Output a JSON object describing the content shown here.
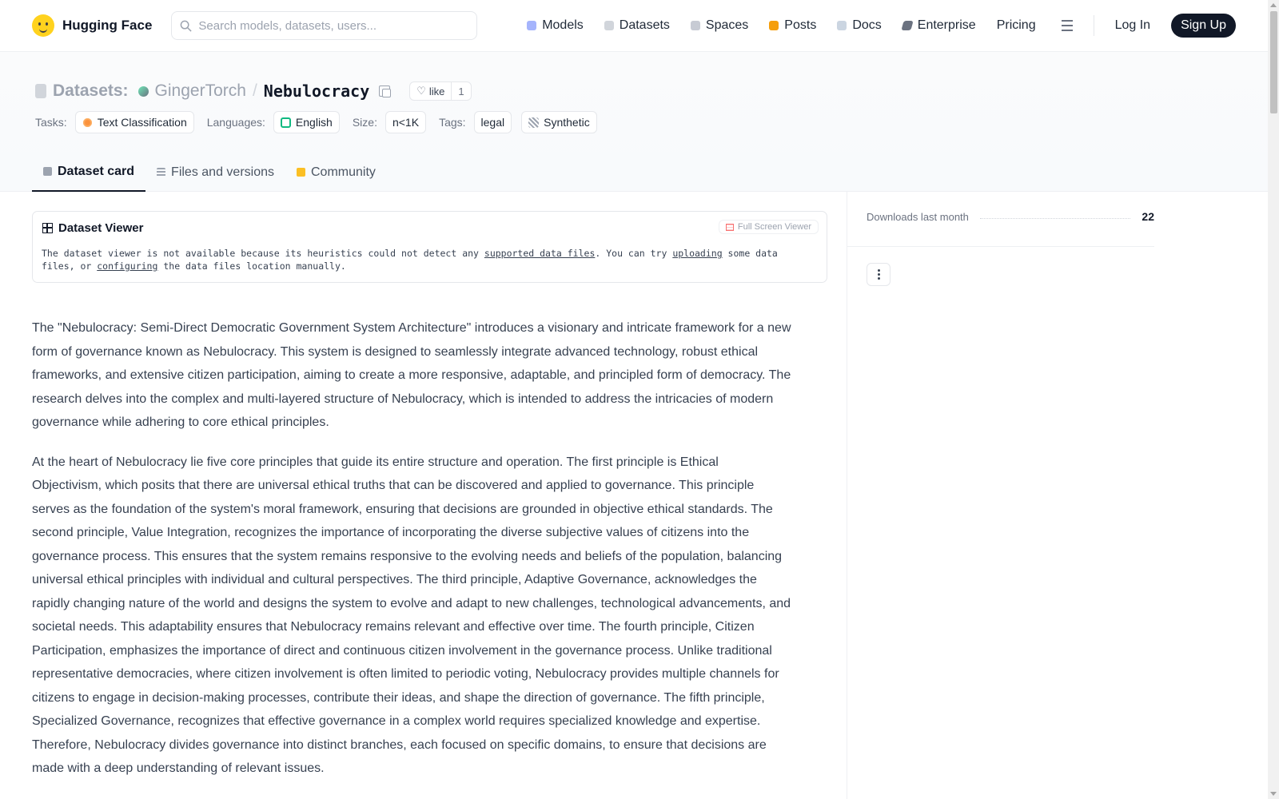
{
  "nav": {
    "brand": "Hugging Face",
    "search_placeholder": "Search models, datasets, users...",
    "links": [
      "Models",
      "Datasets",
      "Spaces",
      "Posts",
      "Docs",
      "Enterprise",
      "Pricing"
    ],
    "login": "Log In",
    "signup": "Sign Up"
  },
  "header": {
    "section_label": "Datasets:",
    "owner": "GingerTorch",
    "separator": "/",
    "repo": "Nebulocracy",
    "like_label": "like",
    "like_count": "1",
    "tags": {
      "tasks_label": "Tasks:",
      "task": "Text Classification",
      "languages_label": "Languages:",
      "language": "English",
      "size_label": "Size:",
      "size": "n<1K",
      "tags_label": "Tags:",
      "tag1": "legal",
      "tag2": "Synthetic"
    },
    "tabs": [
      "Dataset card",
      "Files and versions",
      "Community"
    ]
  },
  "viewer": {
    "title": "Dataset Viewer",
    "fullscreen": "Full Screen Viewer",
    "text_1": "The dataset viewer is not available because its heuristics could not detect any ",
    "link_1": "supported data files",
    "text_2": ". You can try ",
    "link_2": "uploading",
    "text_3": " some data files, or ",
    "link_3": "configuring",
    "text_4": " the data files location manually."
  },
  "article": {
    "p1": "The \"Nebulocracy: Semi-Direct Democratic Government System Architecture\" introduces a visionary and intricate framework for a new form of governance known as Nebulocracy. This system is designed to seamlessly integrate advanced technology, robust ethical frameworks, and extensive citizen participation, aiming to create a more responsive, adaptable, and principled form of democracy. The research delves into the complex and multi-layered structure of Nebulocracy, which is intended to address the intricacies of modern governance while adhering to core ethical principles.",
    "p2": "At the heart of Nebulocracy lie five core principles that guide its entire structure and operation. The first principle is Ethical Objectivism, which posits that there are universal ethical truths that can be discovered and applied to governance. This principle serves as the foundation of the system's moral framework, ensuring that decisions are grounded in objective ethical standards. The second principle, Value Integration, recognizes the importance of incorporating the diverse subjective values of citizens into the governance process. This ensures that the system remains responsive to the evolving needs and beliefs of the population, balancing universal ethical principles with individual and cultural perspectives. The third principle, Adaptive Governance, acknowledges the rapidly changing nature of the world and designs the system to evolve and adapt to new challenges, technological advancements, and societal needs. This adaptability ensures that Nebulocracy remains relevant and effective over time. The fourth principle, Citizen Participation, emphasizes the importance of direct and continuous citizen involvement in the governance process. Unlike traditional representative democracies, where citizen involvement is often limited to periodic voting, Nebulocracy provides multiple channels for citizens to engage in decision-making processes, contribute their ideas, and shape the direction of governance. The fifth principle, Specialized Governance, recognizes that effective governance in a complex world requires specialized knowledge and expertise. Therefore, Nebulocracy divides governance into distinct branches, each focused on specific domains, to ensure that decisions are made with a deep understanding of relevant issues."
  },
  "sidebar": {
    "downloads_label": "Downloads last month",
    "downloads_value": "22"
  }
}
